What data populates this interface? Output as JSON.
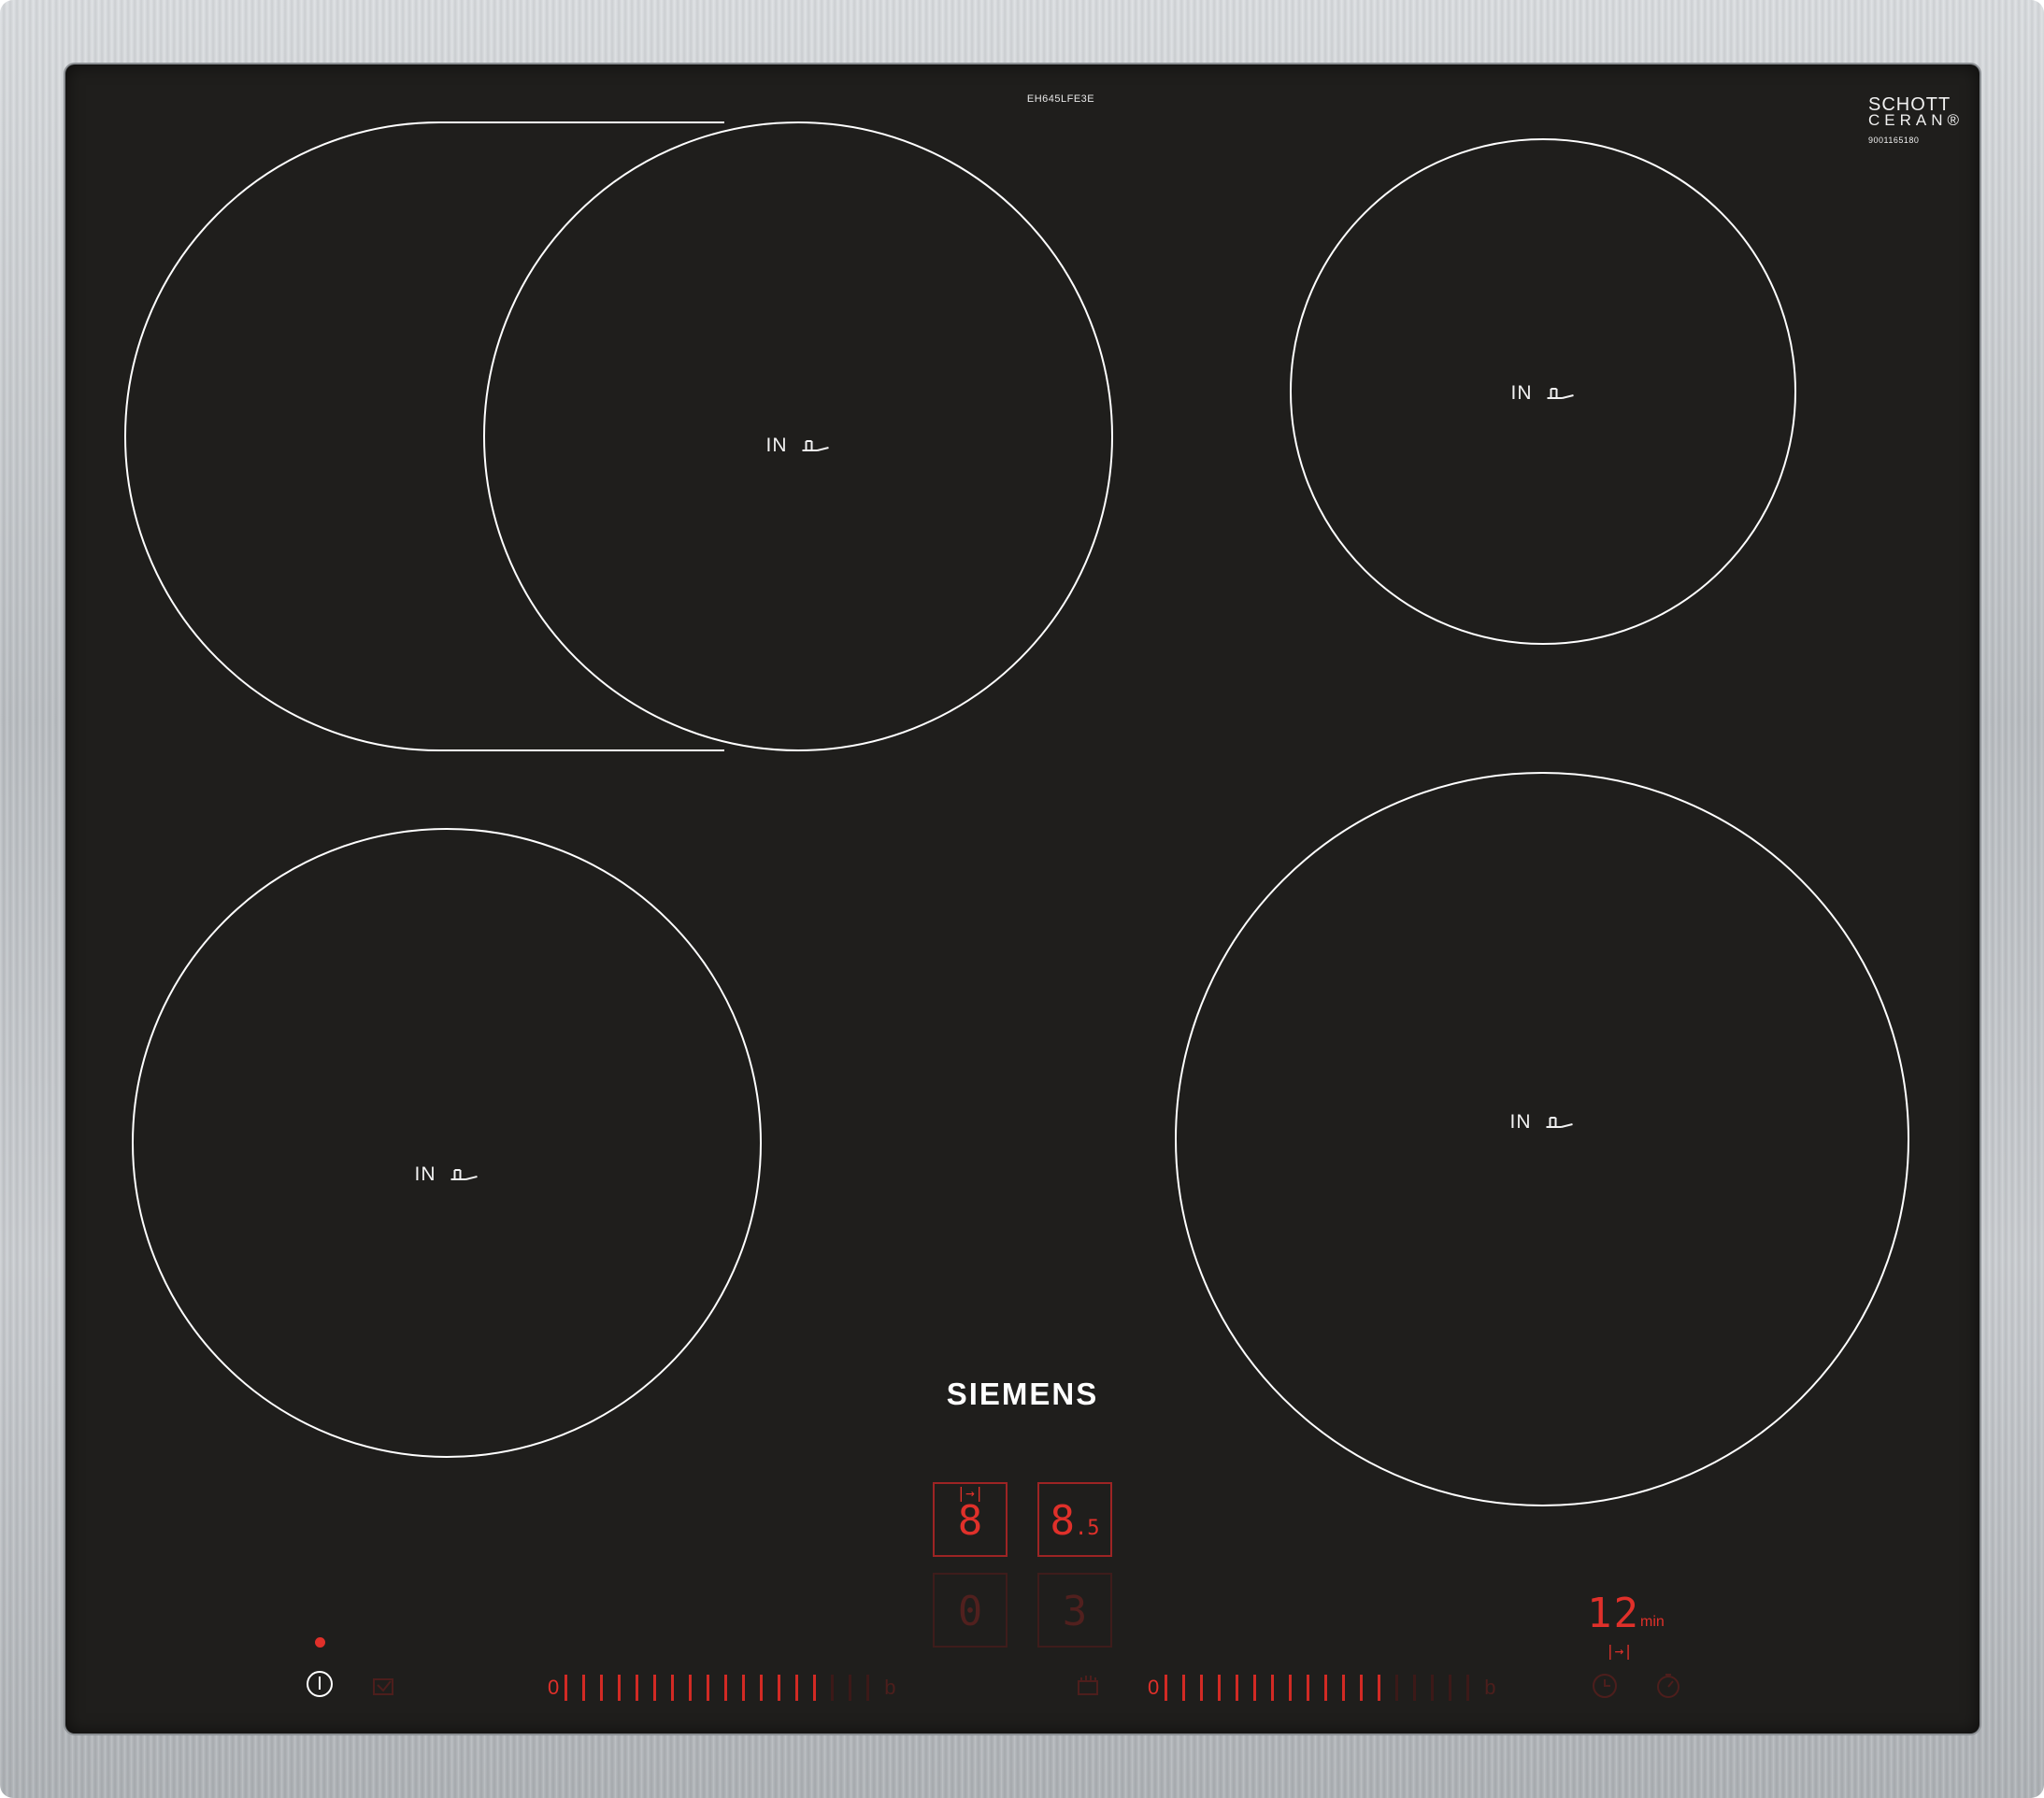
{
  "model_code": "EH645LFE3E",
  "glass_brand": {
    "line1": "SCHOTT",
    "line2": "CERAN®",
    "code": "9001165180"
  },
  "brand": "SIEMENS",
  "zones": [
    {
      "name": "top-left-flex-zone",
      "label": "IN"
    },
    {
      "name": "top-right-zone",
      "label": "IN"
    },
    {
      "name": "bottom-left-zone",
      "label": "IN"
    },
    {
      "name": "bottom-right-zone",
      "label": "IN"
    }
  ],
  "displays": {
    "top_left": {
      "value": "8",
      "mark": "|→|"
    },
    "top_right": {
      "value": "8",
      "sub": ".5"
    },
    "bottom_left": {
      "value": "0"
    },
    "bottom_right": {
      "value": "3"
    }
  },
  "sliders": {
    "left": {
      "start": "0",
      "end": "b",
      "segments": 18,
      "lit": 15
    },
    "right": {
      "start": "0",
      "end": "b",
      "segments": 18,
      "lit": 13
    }
  },
  "timer": {
    "value": "12",
    "unit": "min",
    "mark": "|→|"
  },
  "icons": {
    "power": "power-icon",
    "child_lock": "child-lock-icon",
    "wipe_protect": "wipe-protect-icon",
    "timer": "clock-icon",
    "stopwatch": "stopwatch-icon"
  },
  "colors": {
    "glass": "#1f1e1c",
    "led_red": "#e0302a",
    "frame": "#c3c7cb",
    "outline": "#ffffff"
  }
}
